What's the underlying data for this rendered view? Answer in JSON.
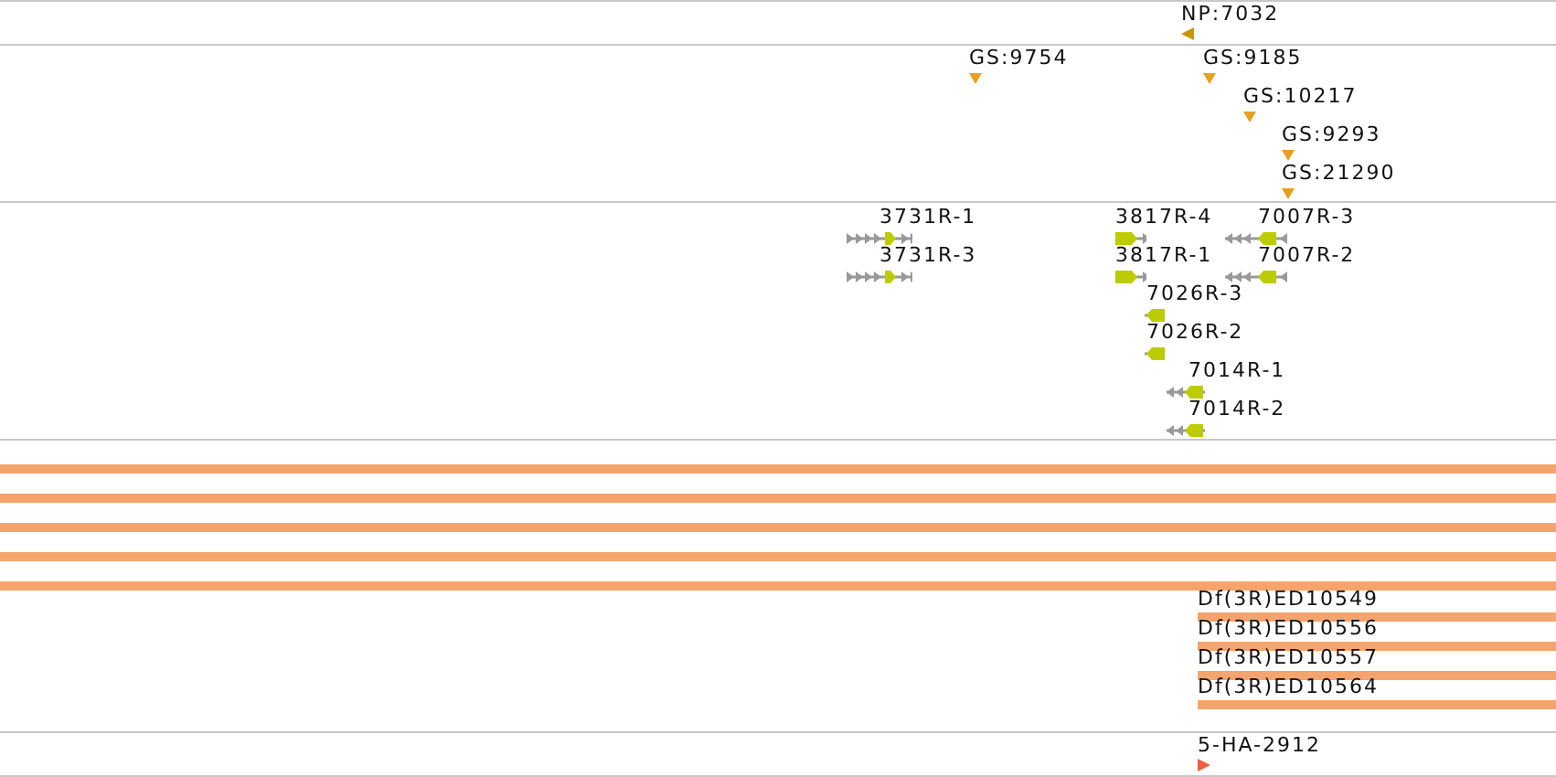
{
  "tracks": [
    {
      "kind": "stranded",
      "color": "#c8960a",
      "features": [
        {
          "label": "NP:7032",
          "reverse": true
        }
      ]
    },
    {
      "kind": "site",
      "color": "#e8a020",
      "features": [
        {
          "label": "GS:9754"
        },
        {
          "label": "GS:9185"
        },
        {
          "label": "GS:10217"
        },
        {
          "label": "GS:9293"
        },
        {
          "label": "GS:21290"
        }
      ]
    },
    {
      "kind": "transcript",
      "features": [
        {
          "label": "3731R-1",
          "reverse": false
        },
        {
          "label": "3731R-3",
          "reverse": false
        },
        {
          "label": "3817R-4",
          "reverse": false
        },
        {
          "label": "3817R-1",
          "reverse": false
        },
        {
          "label": "7007R-3",
          "reverse": true
        },
        {
          "label": "7007R-2",
          "reverse": true
        },
        {
          "label": "7026R-3",
          "reverse": true
        },
        {
          "label": "7026R-2",
          "reverse": true
        },
        {
          "label": "7014R-1",
          "reverse": true
        },
        {
          "label": "7014R-2",
          "reverse": true
        }
      ]
    },
    {
      "kind": "deficiency",
      "features": [
        {
          "kind": "full"
        },
        {
          "kind": "full"
        },
        {
          "kind": "full"
        },
        {
          "kind": "full"
        },
        {
          "kind": "full"
        },
        {
          "kind": "partial",
          "label": "Df(3R)ED10549"
        },
        {
          "kind": "partial",
          "label": "Df(3R)ED10556"
        },
        {
          "kind": "partial",
          "label": "Df(3R)ED10557"
        },
        {
          "kind": "partial",
          "label": "Df(3R)ED10564"
        }
      ]
    },
    {
      "kind": "stranded",
      "color": "#f06040",
      "features": [
        {
          "label": "5-HA-2912",
          "reverse": false
        }
      ]
    }
  ]
}
